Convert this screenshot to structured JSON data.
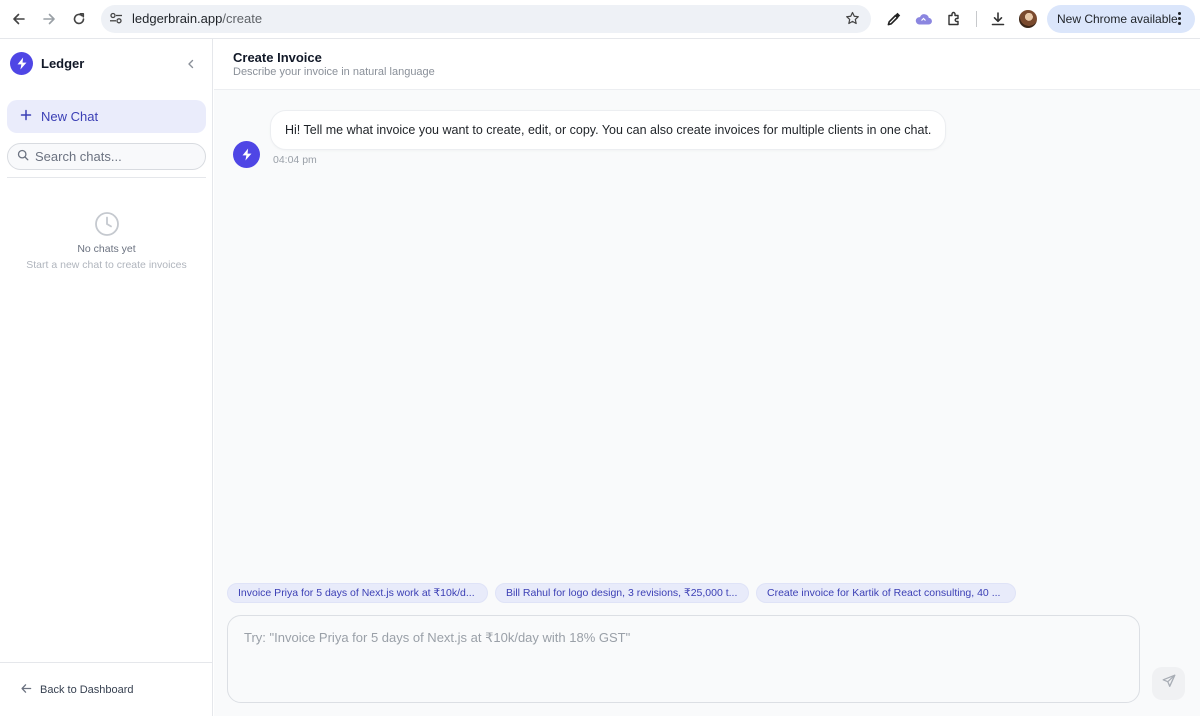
{
  "browser": {
    "url_host": "ledgerbrain.app",
    "url_path": "/create",
    "update_label": "New Chrome available"
  },
  "sidebar": {
    "brand_name": "Ledger",
    "new_chat_label": "New Chat",
    "search_placeholder": "Search chats...",
    "empty_title": "No chats yet",
    "empty_subtitle": "Start a new chat to create invoices",
    "back_label": "Back to Dashboard"
  },
  "header": {
    "title": "Create Invoice",
    "subtitle": "Describe your invoice in natural language"
  },
  "messages": [
    {
      "text": "Hi! Tell me what invoice you want to create, edit, or copy. You can also create invoices for multiple clients in one chat.",
      "time": "04:04 pm"
    }
  ],
  "suggestions": [
    "Invoice Priya for 5 days of Next.js work at ₹10k/d...",
    "Bill Rahul for logo design, 3 revisions, ₹25,000 t...",
    "Create invoice for Kartik of React consulting, 40 ..."
  ],
  "composer": {
    "placeholder": "Try: \"Invoice Priya for 5 days of Next.js at ₹10k/day with 18% GST\""
  },
  "colors": {
    "accent": "#4f46e5",
    "accent_soft": "#eaecfb",
    "update_pill": "#dbe6fb"
  }
}
